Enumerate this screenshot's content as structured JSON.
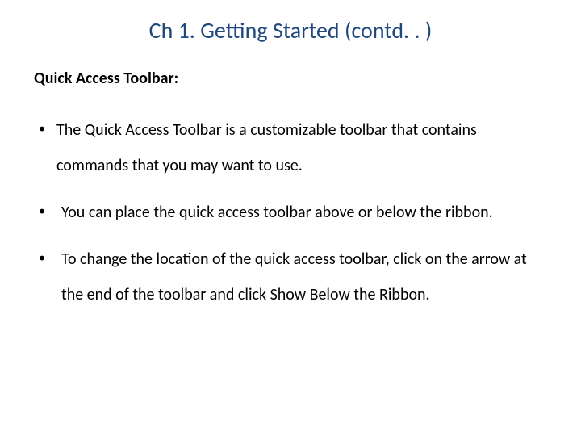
{
  "title": "Ch 1. Getting Started (contd. . )",
  "subtitle": "Quick Access Toolbar:",
  "bullets": [
    "The Quick Access Toolbar is a customizable toolbar that contains commands that you may want to use.",
    "You can place the quick access toolbar above or below the ribbon.",
    "To change the location of the quick access toolbar, click on the arrow at the end of the toolbar and click Show Below the Ribbon."
  ]
}
